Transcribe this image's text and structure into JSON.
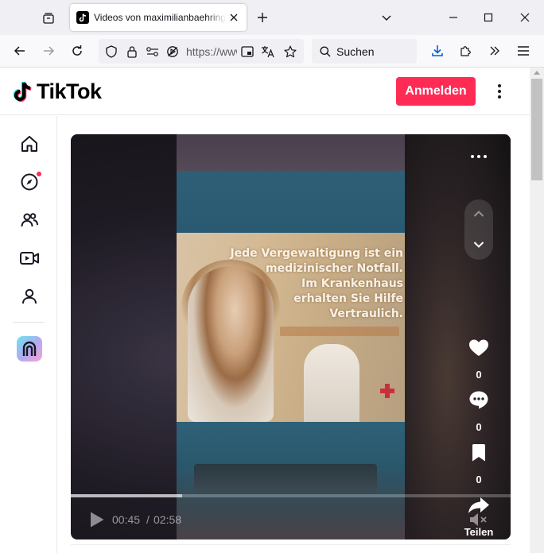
{
  "browser": {
    "tab_title": "Videos von maximilianbaehring",
    "url": "https://www.tiktok.com",
    "search_placeholder": "Suchen"
  },
  "tiktok": {
    "logo_text": "TikTok",
    "login_label": "Anmelden",
    "brand_color": "#fe2c55",
    "sidebar": [
      {
        "icon": "home-icon"
      },
      {
        "icon": "explore-icon",
        "badge": true
      },
      {
        "icon": "following-icon"
      },
      {
        "icon": "live-icon"
      },
      {
        "icon": "profile-icon"
      }
    ]
  },
  "video": {
    "poster_lines": [
      "Jede Vergewaltigung ist ein",
      "medizinischer Notfall.",
      "Im Krankenhaus",
      "erhalten Sie Hilfe",
      "Vertraulich."
    ],
    "like_count": "0",
    "comment_count": "0",
    "save_count": "0",
    "share_label": "Teilen",
    "time_current": "00:45",
    "time_separator": "/",
    "time_total": "02:58",
    "progress": 0.253
  }
}
